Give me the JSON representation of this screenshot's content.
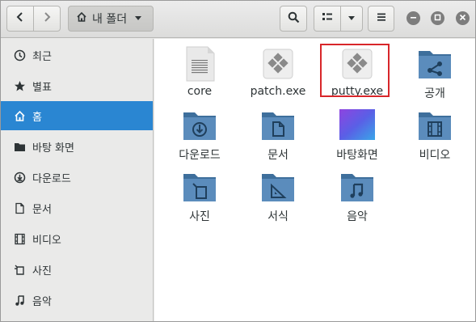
{
  "window": {
    "title": "내 폴더"
  },
  "header": {
    "path_label": "내 폴더",
    "buttons": {
      "back": "back-icon",
      "forward": "forward-icon",
      "search": "search-icon",
      "view": "list-view-icon",
      "view_menu": "chevron-down-icon",
      "menu": "hamburger-icon",
      "minimize": "minimize-icon",
      "maximize": "maximize-icon",
      "close": "close-icon"
    }
  },
  "sidebar": {
    "items": [
      {
        "label": "최근",
        "icon": "clock-icon"
      },
      {
        "label": "별표",
        "icon": "star-icon"
      },
      {
        "label": "홈",
        "icon": "home-icon",
        "active": true
      },
      {
        "label": "바탕 화면",
        "icon": "desktop-folder-icon"
      },
      {
        "label": "다운로드",
        "icon": "download-icon"
      },
      {
        "label": "문서",
        "icon": "document-icon"
      },
      {
        "label": "비디오",
        "icon": "film-icon"
      },
      {
        "label": "사진",
        "icon": "camera-icon"
      },
      {
        "label": "음악",
        "icon": "music-icon"
      }
    ]
  },
  "files": [
    {
      "name": "core",
      "icon": "text-file-icon"
    },
    {
      "name": "patch.exe",
      "icon": "executable-icon"
    },
    {
      "name": "putty.exe",
      "icon": "executable-icon"
    },
    {
      "name": "공개",
      "icon": "share-folder-icon"
    },
    {
      "name": "다운로드",
      "icon": "download-folder-icon"
    },
    {
      "name": "문서",
      "icon": "documents-folder-icon"
    },
    {
      "name": "바탕화면",
      "icon": "desktop-folder-icon"
    },
    {
      "name": "비디오",
      "icon": "video-folder-icon"
    },
    {
      "name": "사진",
      "icon": "pictures-folder-icon"
    },
    {
      "name": "서식",
      "icon": "templates-folder-icon"
    },
    {
      "name": "음악",
      "icon": "music-folder-icon"
    }
  ],
  "colors": {
    "accent": "#2a86d2",
    "folder": "#4a7fb0",
    "highlight": "#d8262a"
  }
}
